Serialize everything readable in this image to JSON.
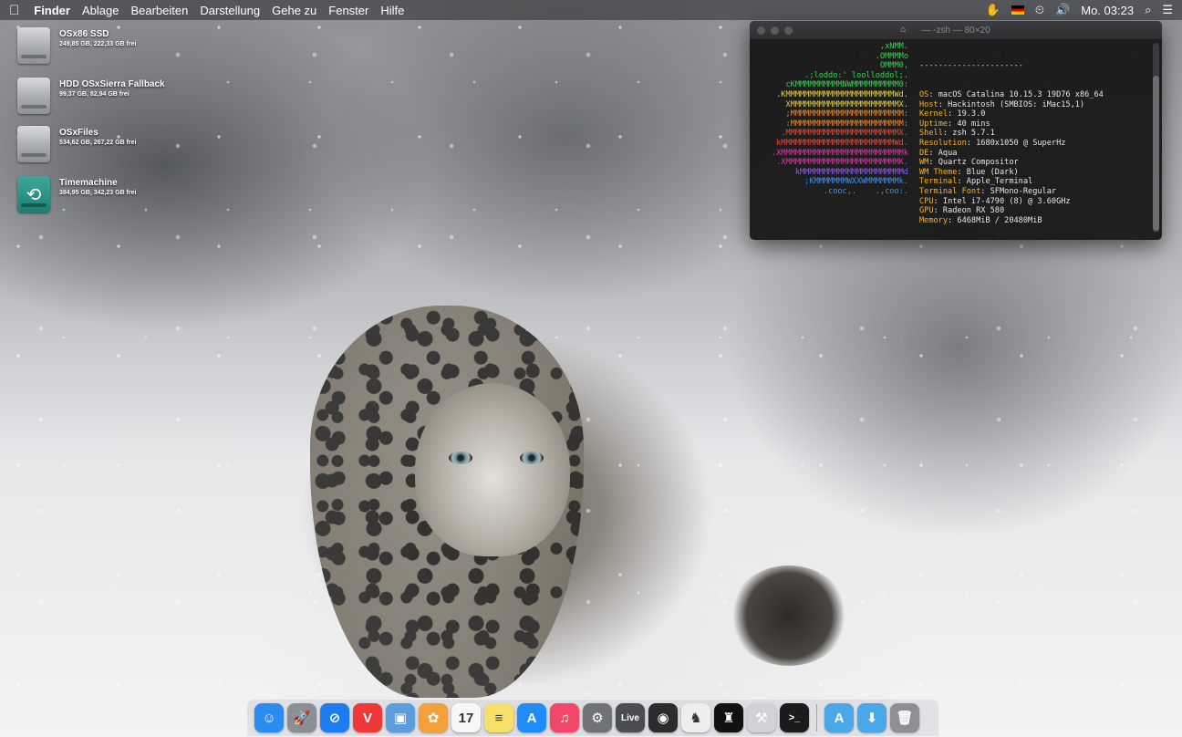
{
  "menubar": {
    "app": "Finder",
    "items": [
      "Ablage",
      "Bearbeiten",
      "Darstellung",
      "Gehe zu",
      "Fenster",
      "Hilfe"
    ],
    "clock": "Mo. 03:23",
    "icons": [
      "apple-icon",
      "hand-icon",
      "flag-icon",
      "time-machine-icon",
      "volume-icon",
      "spotlight-icon",
      "notification-center-icon"
    ]
  },
  "desktop": {
    "disks": [
      {
        "name": "OSx86 SSD",
        "info": "249,85 GB, 222,33 GB frei"
      },
      {
        "name": "HDD OSxSierra Fallback",
        "info": "99,37 GB, 82,94 GB frei"
      },
      {
        "name": "OSxFiles",
        "info": "534,62 GB, 267,22 GB frei"
      },
      {
        "name": "Timemachine",
        "info": "384,95 GB, 342,23 GB frei"
      }
    ]
  },
  "terminal": {
    "title": "— -zsh — 80×20",
    "art": [
      {
        "t": "  ,xNMM.",
        "c": "#39d353"
      },
      {
        "t": ".OMMMMo",
        "c": "#39d353"
      },
      {
        "t": "OMMM0,",
        "c": "#39d353"
      },
      {
        "t": ".;loddo:' loolloddol;.",
        "c": "#39d353"
      },
      {
        "t": "cKMMMMMMMMMMNWMMMMMMMMMM0:",
        "c": "#39d353"
      },
      {
        "t": ".KMMMMMMMMMMMMMMMMMMMMMMMWd.",
        "c": "#e8d23a"
      },
      {
        "t": "XMMMMMMMMMMMMMMMMMMMMMMMX.",
        "c": "#e8d23a"
      },
      {
        "t": ";MMMMMMMMMMMMMMMMMMMMMMMM:",
        "c": "#f08a2a"
      },
      {
        "t": ":MMMMMMMMMMMMMMMMMMMMMMMM:",
        "c": "#f08a2a"
      },
      {
        "t": ".MMMMMMMMMMMMMMMMMMMMMMMMX.",
        "c": "#e44a3a"
      },
      {
        "t": "kMMMMMMMMMMMMMMMMMMMMMMMMWd.",
        "c": "#e44a3a"
      },
      {
        "t": ".XMMMMMMMMMMMMMMMMMMMMMMMMMMk",
        "c": "#d93aa8"
      },
      {
        "t": ".XMMMMMMMMMMMMMMMMMMMMMMMMK.",
        "c": "#d93aa8"
      },
      {
        "t": "kMMMMMMMMMMMMMMMMMMMMMMd",
        "c": "#8b5cf6"
      },
      {
        "t": ";KMMMMMMMWXXWMMMMMMMk.",
        "c": "#3f8ff0"
      },
      {
        "t": ".cooc,.    .,coo:.",
        "c": "#3f8ff0"
      }
    ],
    "separator": "----------------------",
    "info": [
      {
        "k": "OS",
        "v": "macOS Catalina 10.15.3 19D76 x86_64"
      },
      {
        "k": "Host",
        "v": "Hackintosh (SMBIOS: iMac15,1)"
      },
      {
        "k": "Kernel",
        "v": "19.3.0"
      },
      {
        "k": "Uptime",
        "v": "40 mins"
      },
      {
        "k": "Shell",
        "v": "zsh 5.7.1"
      },
      {
        "k": "Resolution",
        "v": "1680x1050 @ SuperHz"
      },
      {
        "k": "DE",
        "v": "Aqua"
      },
      {
        "k": "WM",
        "v": "Quartz Compositor"
      },
      {
        "k": "WM Theme",
        "v": "Blue (Dark)"
      },
      {
        "k": "Terminal",
        "v": "Apple_Terminal"
      },
      {
        "k": "Terminal Font",
        "v": "SFMono-Regular"
      },
      {
        "k": "CPU",
        "v": "Intel i7-4790 (8) @ 3.60GHz"
      },
      {
        "k": "GPU",
        "v": "Radeon RX 580"
      },
      {
        "k": "Memory",
        "v": "6468MiB / 20480MiB"
      }
    ],
    "swatches_top": [
      "#000000",
      "#c4161c",
      "#22b14c",
      "#a6a615",
      "#1c3de0",
      "#b51ad6",
      "#17a8b5",
      "#c8c8c8"
    ],
    "swatches_bottom": [
      "#5a5a5a",
      "#ff3b30",
      "#3ce83c",
      "#f2f23a",
      "#3c64ff",
      "#f03cf0",
      "#3cf0f0",
      "#ffffff"
    ]
  },
  "dock": {
    "apps": [
      {
        "name": "finder-icon",
        "bg": "#2a8cf0",
        "glyph": "☺"
      },
      {
        "name": "launchpad-icon",
        "bg": "#8a8f96",
        "glyph": "🚀"
      },
      {
        "name": "safari-icon",
        "bg": "#1e7cf0",
        "glyph": "⊘"
      },
      {
        "name": "vivaldi-icon",
        "bg": "#ef3939",
        "glyph": "V"
      },
      {
        "name": "preview-icon",
        "bg": "#5c9de0",
        "glyph": "▣"
      },
      {
        "name": "photos-icon",
        "bg": "#f4a03a",
        "glyph": "✿"
      },
      {
        "name": "calendar-icon",
        "bg": "#f7f7f7",
        "glyph": "17"
      },
      {
        "name": "notes-icon",
        "bg": "#f6e06a",
        "glyph": "≡"
      },
      {
        "name": "app-store-icon",
        "bg": "#1f8cf7",
        "glyph": "A"
      },
      {
        "name": "music-icon",
        "bg": "#f1476a",
        "glyph": "♫"
      },
      {
        "name": "system-preferences-icon",
        "bg": "#6f7378",
        "glyph": "⚙"
      },
      {
        "name": "live-icon",
        "bg": "#4a4e52",
        "glyph": "Live"
      },
      {
        "name": "geforce-icon",
        "bg": "#2c2c2c",
        "glyph": "◉"
      },
      {
        "name": "little-snitch-icon",
        "bg": "#eeeeee",
        "glyph": "♞"
      },
      {
        "name": "chess-icon",
        "bg": "#111111",
        "glyph": "♜"
      },
      {
        "name": "xcode-icon",
        "bg": "#cfd3d8",
        "glyph": "⚒"
      },
      {
        "name": "terminal-icon",
        "bg": "#1b1b1b",
        "glyph": ">_"
      }
    ],
    "folders": [
      {
        "name": "applications-folder-icon",
        "bg": "#4aa8e8",
        "glyph": "A"
      },
      {
        "name": "downloads-folder-icon",
        "bg": "#4aa8e8",
        "glyph": "⬇"
      },
      {
        "name": "trash-icon",
        "bg": "#8c9096",
        "glyph": "🗑"
      }
    ]
  }
}
